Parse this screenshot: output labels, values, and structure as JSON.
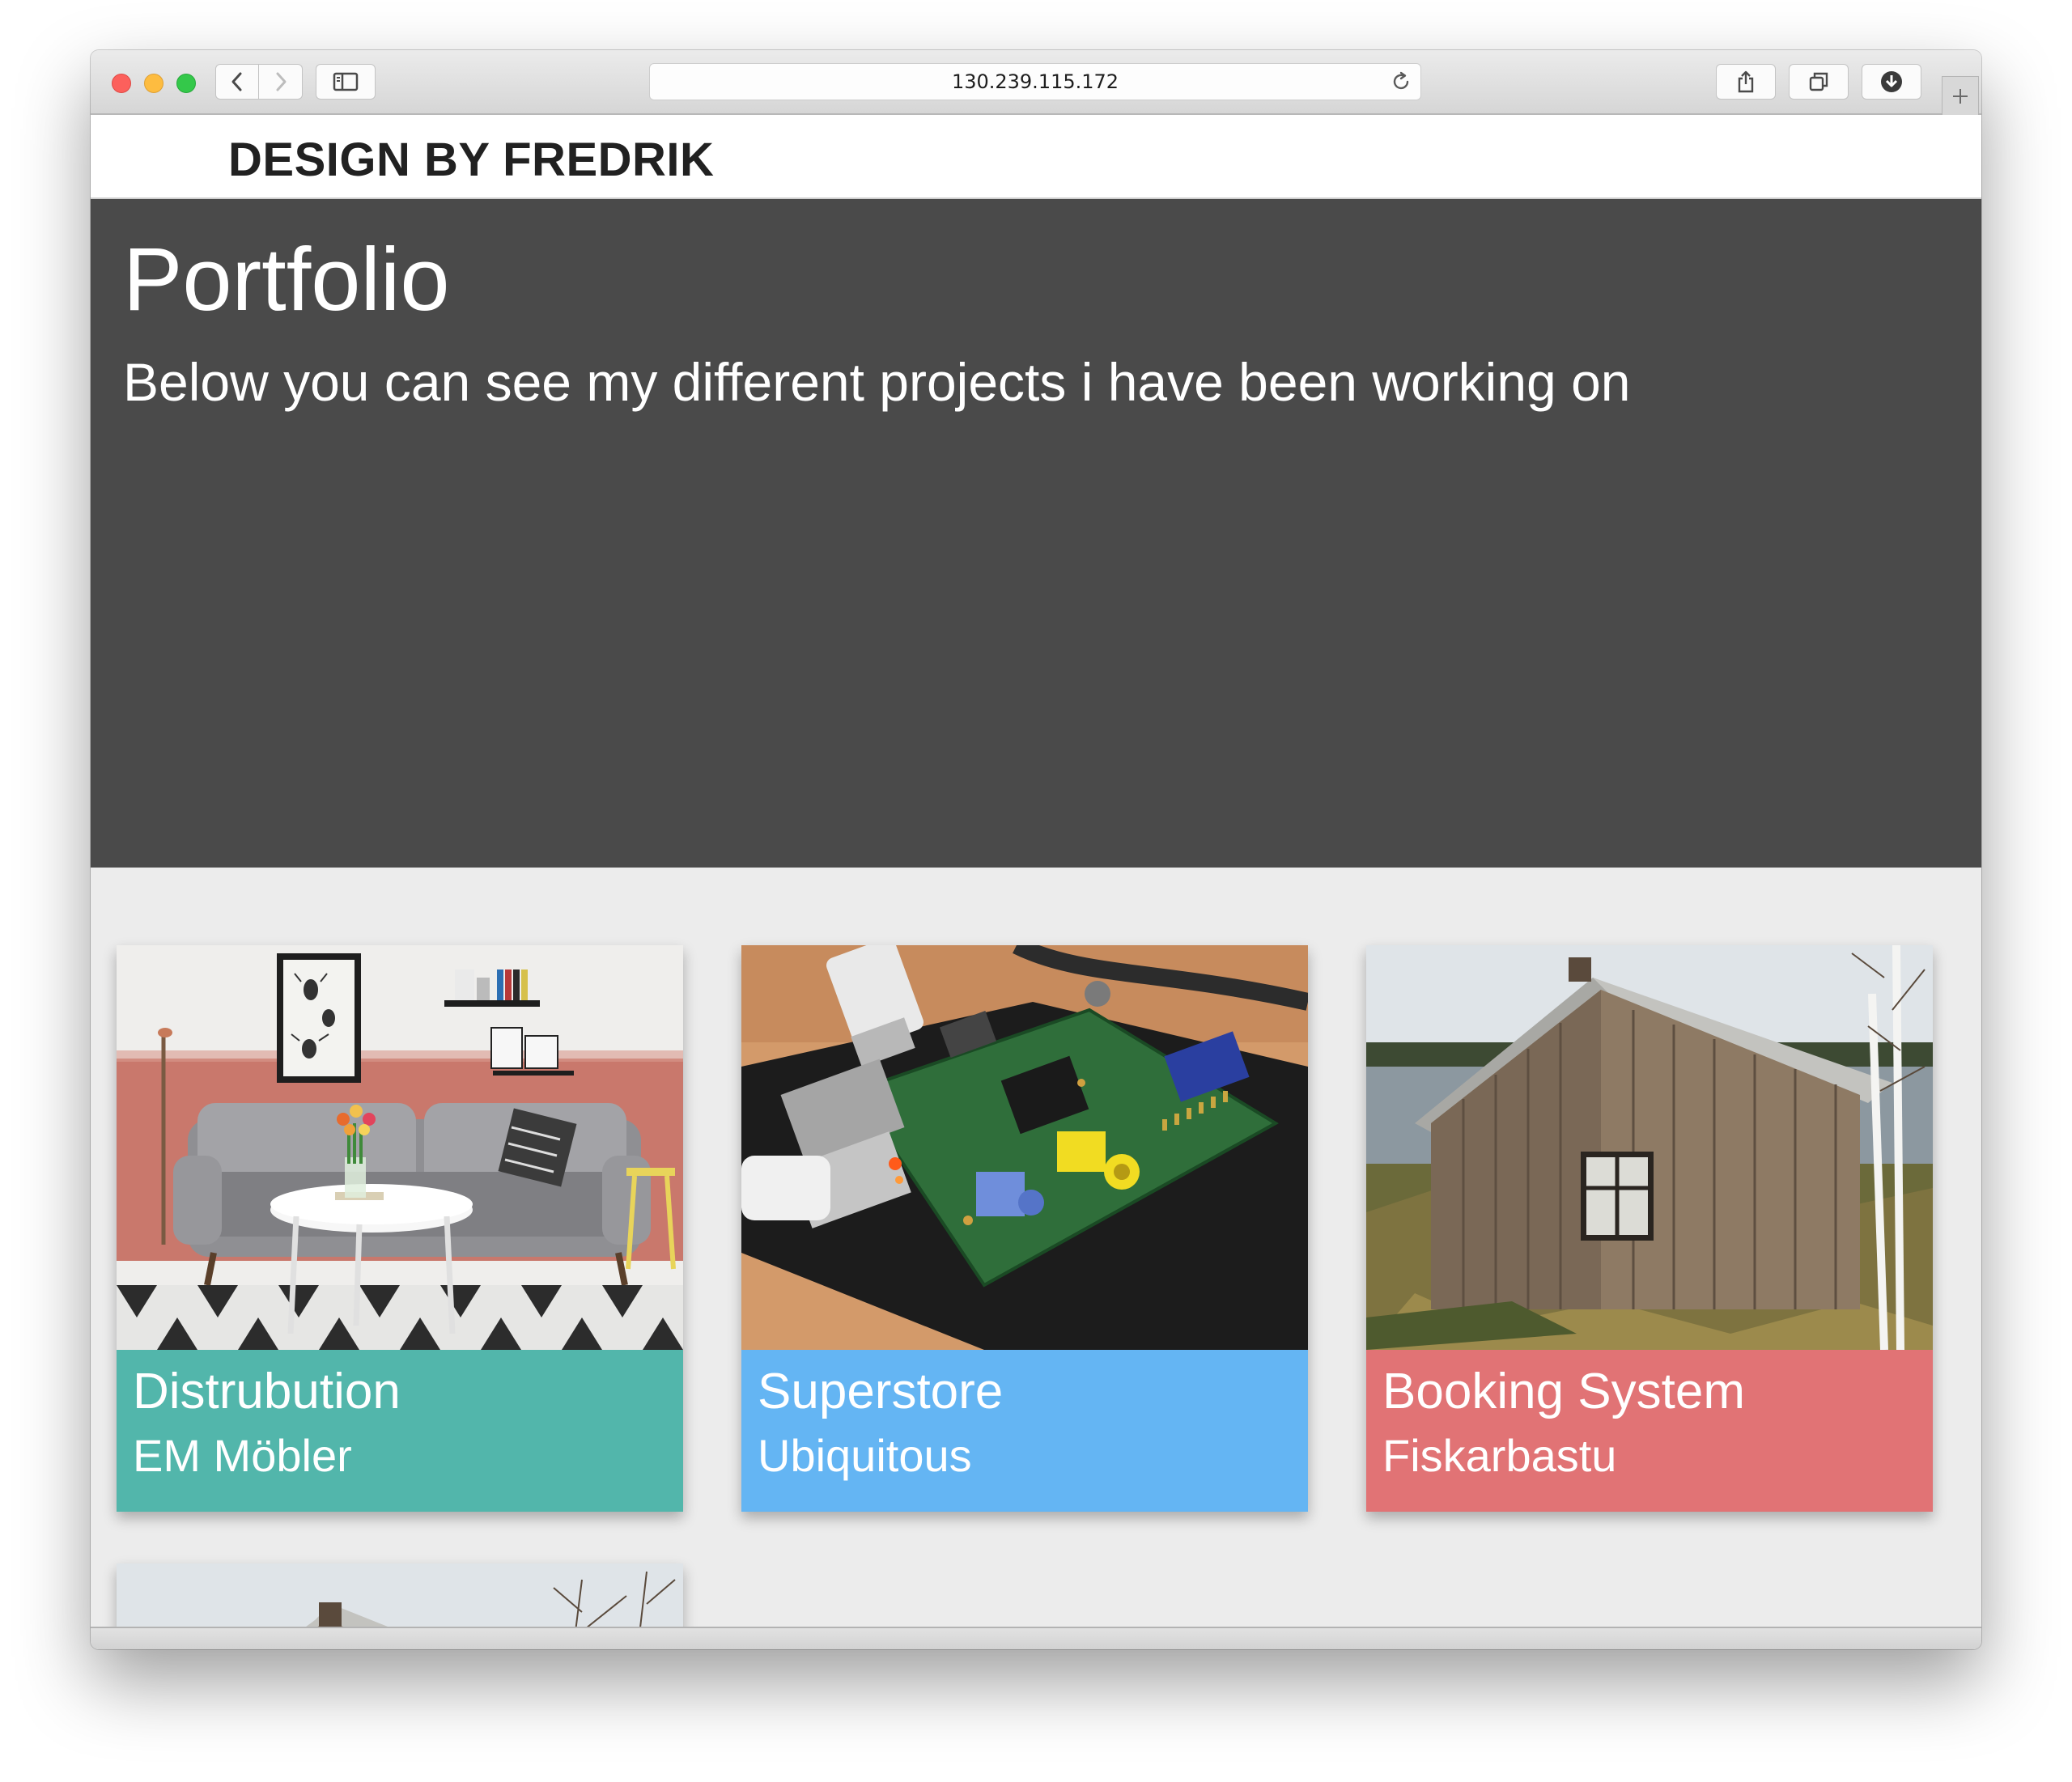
{
  "browser": {
    "url": "130.239.115.172",
    "icons": {
      "back": "chevron-left-icon",
      "forward": "chevron-right-icon",
      "sidebar": "sidebar-icon",
      "reload": "reload-icon",
      "share": "share-icon",
      "tabs": "tabs-icon",
      "download": "download-icon",
      "new_tab": "plus-icon"
    }
  },
  "header": {
    "brand": "DESIGN BY FREDRIK"
  },
  "hero": {
    "title": "Portfolio",
    "subtitle": "Below you can see my different projects i have been working on"
  },
  "projects": [
    {
      "title": "Distrubution",
      "client": "EM Möbler",
      "color": "#52b6ab",
      "image": "living-room-photo"
    },
    {
      "title": "Superstore",
      "client": "Ubiquitous",
      "color": "#64b5f3",
      "image": "circuit-board-photo"
    },
    {
      "title": "Booking System",
      "client": "Fiskarbastu",
      "color": "#e17375",
      "image": "wooden-cabin-photo"
    },
    {
      "title": "",
      "client": "",
      "color": "#ffffff",
      "image": "wooden-cabin-photo"
    }
  ],
  "colors": {
    "hero_bg": "#4a4a4a",
    "page_bg": "#ececec",
    "brand_text": "#212121"
  }
}
